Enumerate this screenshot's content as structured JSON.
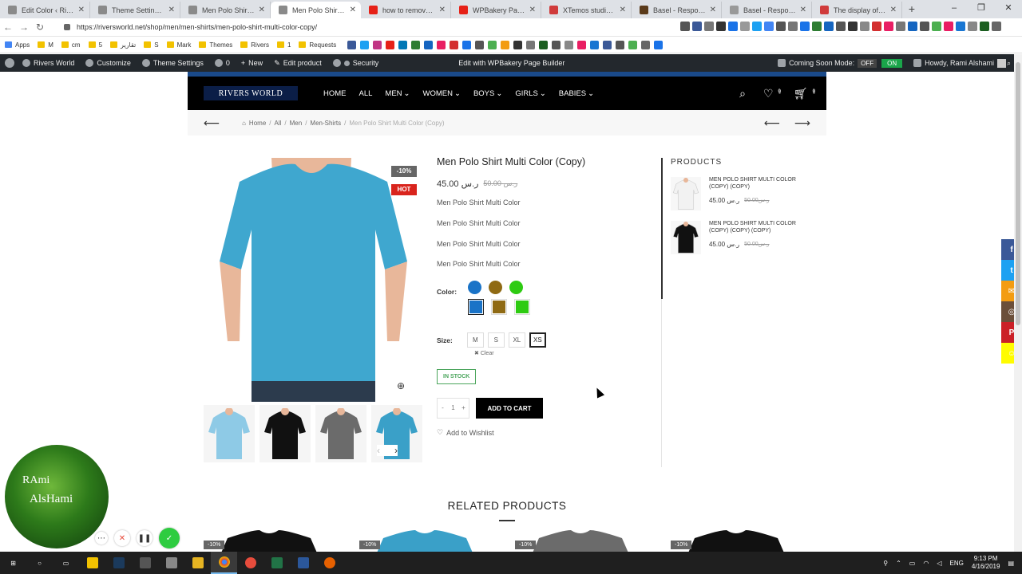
{
  "browser": {
    "tabs": [
      {
        "title": "Edit Color ‹ Rivers W",
        "color": "#8a8a8a"
      },
      {
        "title": "Theme Settings ‹ Ri",
        "color": "#8a8a8a"
      },
      {
        "title": "Men Polo Shirt Mult",
        "color": "#8a8a8a"
      },
      {
        "title": "Men Polo Shirt Mult",
        "color": "#8a8a8a",
        "active": true
      },
      {
        "title": "how to remove the",
        "color": "#e62117"
      },
      {
        "title": "WPBakery Page Buil",
        "color": "#e62117"
      },
      {
        "title": "XTemos studio - Pro",
        "color": "#d03b3b"
      },
      {
        "title": "Basel - Responsive",
        "color": "#5a3a1a"
      },
      {
        "title": "Basel - Responsive",
        "color": "#999999"
      },
      {
        "title": "The display of prod",
        "color": "#d03b3b"
      }
    ],
    "url": "https://riversworld.net/shop/men/men-shirts/men-polo-shirt-multi-color-copy/",
    "bookmarks": [
      "Apps",
      "M",
      "cm",
      "5",
      "تقارير",
      "S",
      "Mark",
      "Themes",
      "Rivers",
      "1",
      "Requests"
    ]
  },
  "wp_admin_bar": {
    "site": "Rivers World",
    "customize": "Customize",
    "theme_settings": "Theme Settings",
    "comments": "0",
    "new": "New",
    "edit_product": "Edit product",
    "security": "Security",
    "wpbakery": "Edit with WPBakery Page Builder",
    "coming_soon": "Coming Soon Mode:",
    "off": "OFF",
    "on": "ON",
    "howdy": "Howdy, Rami Alshami"
  },
  "header": {
    "logo": "RIVERS WORLD",
    "menu": [
      "HOME",
      "ALL",
      "MEN",
      "WOMEN",
      "BOYS",
      "GIRLS",
      "BABIES"
    ],
    "wishlist_count": "0",
    "cart_count": "0"
  },
  "breadcrumb": [
    "Home",
    "All",
    "Men",
    "Men-Shirts",
    "Men Polo Shirt Multi Color (Copy)"
  ],
  "product": {
    "discount_tag": "-10%",
    "hot_tag": "HOT",
    "title": "Men Polo Shirt Multi Color (Copy)",
    "price": "45.00",
    "currency": "ر.س",
    "old_price": "50.00",
    "desc_lines": [
      "Men Polo Shirt Multi Color",
      "Men Polo Shirt Multi Color",
      "Men Polo Shirt Multi Color",
      "Men Polo Shirt Multi Color"
    ],
    "color_label": "Color:",
    "colors": [
      "#1a73c7",
      "#8f6a14",
      "#2ecb12"
    ],
    "selected_color": "#1a73c7",
    "size_label": "Size:",
    "sizes": [
      "M",
      "S",
      "XL",
      "XS"
    ],
    "selected_size": "XS",
    "clear": "Clear",
    "stock": "IN STOCK",
    "qty": "1",
    "minus": "-",
    "plus": "+",
    "add_to_cart": "ADD TO CART",
    "wishlist": "Add to Wishlist",
    "thumb_colors": [
      "#8ecae6",
      "#111111",
      "#6b6b6b",
      "#3aa0c8"
    ]
  },
  "sidebar": {
    "title": "PRODUCTS",
    "items": [
      {
        "name": "MEN POLO SHIRT MULTI COLOR (COPY) (COPY)",
        "price": "45.00",
        "currency": "ر.س",
        "old_price": "50.00",
        "color": "#f2f2f2"
      },
      {
        "name": "MEN POLO SHIRT MULTI COLOR (COPY) (COPY) (COPY)",
        "price": "45.00",
        "currency": "ر.س",
        "old_price": "50.00",
        "color": "#111111"
      }
    ]
  },
  "related": {
    "title": "RELATED PRODUCTS",
    "items": [
      {
        "tag": "-10%",
        "color": "#111111"
      },
      {
        "tag": "-10%",
        "color": "#3aa0c8"
      },
      {
        "tag": "-10%",
        "color": "#6b6b6b"
      },
      {
        "tag": "-10%",
        "color": "#111111"
      }
    ]
  },
  "social": [
    {
      "icon": "facebook-icon",
      "color": "#3b5998",
      "glyph": "f"
    },
    {
      "icon": "twitter-icon",
      "color": "#1da1f2",
      "glyph": "t"
    },
    {
      "icon": "email-icon",
      "color": "#f39c12",
      "glyph": "✉"
    },
    {
      "icon": "instagram-icon",
      "color": "#6b4f3a",
      "glyph": "◎"
    },
    {
      "icon": "pinterest-icon",
      "color": "#cb2027",
      "glyph": "P"
    },
    {
      "icon": "snapchat-icon",
      "color": "#fffc00",
      "glyph": "☺"
    }
  ],
  "overlay": {
    "line1": "RAmi",
    "line2": "AlsHami"
  },
  "taskbar": {
    "lang": "ENG",
    "time": "9:13 PM",
    "date": "4/16/2019"
  }
}
